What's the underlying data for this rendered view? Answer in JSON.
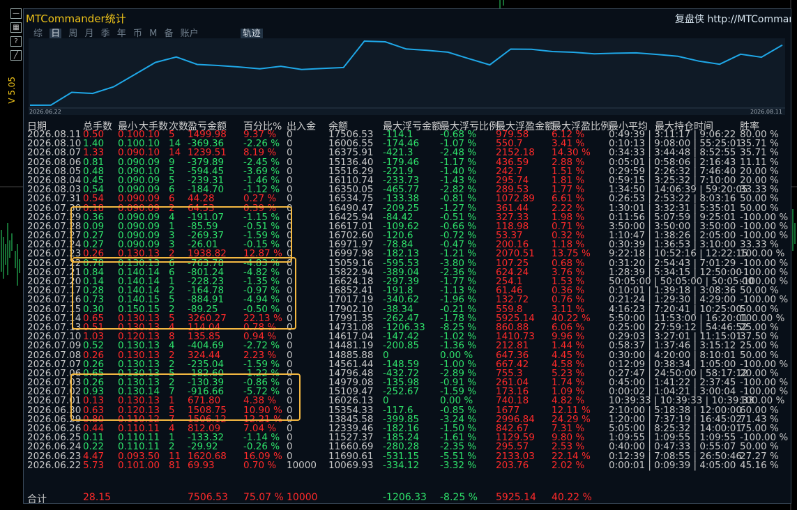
{
  "window": {
    "title": "MTCommander统计",
    "link": "复盘侠 http://MTCommander",
    "version": "V 5.05"
  },
  "tabs": [
    "综",
    "日",
    "周",
    "月",
    "季",
    "年",
    "币",
    "M",
    "备",
    "账户"
  ],
  "active_tab": "日",
  "track_button": "轨迹",
  "chart_data": {
    "type": "line",
    "title": "",
    "x_start_label": "2026.06.22",
    "x_end_label": "2026.08.11",
    "series": [
      {
        "values": [
          10069.93,
          10080,
          11660.69,
          11527.37,
          12339.46,
          13845.58,
          15354.33,
          16026.13,
          15109.47,
          14979.08,
          14796.48,
          14561.44,
          14885.88,
          14481.19,
          14617.04,
          14731.08,
          17991.35,
          17902.1,
          17017.19,
          16852.41,
          16624.18,
          15822.94,
          15059.16,
          16997.98,
          16971.97,
          16702.6,
          16617.01,
          16425.94,
          16490.47,
          16534.75,
          16350.05,
          16110.74,
          15516.29,
          15136.4,
          16375.91,
          16006.55,
          17506.53
        ]
      }
    ],
    "line_color": "#1fa8e8"
  },
  "columns": [
    "日期",
    "总手数",
    "最小",
    "大手数",
    "次数",
    "盈亏金额",
    "百分比%",
    "出入金",
    "余额",
    "最大浮亏金额",
    "最大浮亏比例",
    "最大浮盈金额",
    "最大浮盈比例",
    "最小平均",
    "最大持仓时间",
    "胜率"
  ],
  "rows": [
    {
      "date": "2026.08.11",
      "lots": "0.50",
      "mn": "0.10",
      "mx": "0.10",
      "cnt": "5",
      "pnl": "1499.98",
      "pct": "9.37 %",
      "io": "0",
      "bal": "17506.53",
      "fl": "-114.1",
      "flp": "-0.68 %",
      "fp": "979.58",
      "fpp": "6.12 %",
      "tm": "0:49:39 | 3:11:17 | 9:06:22",
      "win": "80.00 %",
      "s": 1
    },
    {
      "date": "2026.08.10",
      "lots": "1.40",
      "mn": "0.10",
      "mx": "0.10",
      "cnt": "14",
      "pnl": "-369.36",
      "pct": "-2.26 %",
      "io": "0",
      "bal": "16006.55",
      "fl": "-174.46",
      "flp": "-1.07 %",
      "fp": "550.7",
      "fpp": "3.41 %",
      "tm": "0:10:13 | 9:08:00 | 55:25:01",
      "win": "35.71 %",
      "s": -1
    },
    {
      "date": "2026.08.07",
      "lots": "1.33",
      "mn": "0.09",
      "mx": "0.10",
      "cnt": "14",
      "pnl": "1239.51",
      "pct": "8.19 %",
      "io": "0",
      "bal": "16375.91",
      "fl": "-421.3",
      "flp": "-2.48 %",
      "fp": "2152.18",
      "fpp": "14.30 %",
      "tm": "0:34:33 | 3:44:48 | 8:52:55",
      "win": "35.71 %",
      "s": 1
    },
    {
      "date": "2026.08.06",
      "lots": "0.81",
      "mn": "0.09",
      "mx": "0.09",
      "cnt": "9",
      "pnl": "-379.89",
      "pct": "-2.45 %",
      "io": "0",
      "bal": "15136.40",
      "fl": "-179.46",
      "flp": "-1.17 %",
      "fp": "436.59",
      "fpp": "2.88 %",
      "tm": "0:05:01 | 0:58:06 | 2:16:43",
      "win": "11.11 %",
      "s": -1
    },
    {
      "date": "2026.08.05",
      "lots": "0.48",
      "mn": "0.09",
      "mx": "0.10",
      "cnt": "5",
      "pnl": "-594.45",
      "pct": "-3.69 %",
      "io": "0",
      "bal": "15516.29",
      "fl": "-221.9",
      "flp": "-1.40 %",
      "fp": "242.7",
      "fpp": "1.51 %",
      "tm": "0:29:59 | 2:26:32 | 7:46:40",
      "win": "20.00 %",
      "s": -1
    },
    {
      "date": "2026.08.04",
      "lots": "0.45",
      "mn": "0.09",
      "mx": "0.09",
      "cnt": "5",
      "pnl": "-239.31",
      "pct": "-1.46 %",
      "io": "0",
      "bal": "16110.74",
      "fl": "-233.73",
      "flp": "-1.43 %",
      "fp": "295.74",
      "fpp": "1.81 %",
      "tm": "0:59:15 | 3:25:32 | 7:10:00",
      "win": "20.00 %",
      "s": -1
    },
    {
      "date": "2026.08.03",
      "lots": "0.54",
      "mn": "0.09",
      "mx": "0.09",
      "cnt": "6",
      "pnl": "-184.70",
      "pct": "-1.12 %",
      "io": "0",
      "bal": "16350.05",
      "fl": "-465.77",
      "flp": "-2.82 %",
      "fp": "289.53",
      "fpp": "1.77 %",
      "tm": "1:34:50 | 14:06:39 | 59:20:05",
      "win": "33.33 %",
      "s": -1
    },
    {
      "date": "2026.07.31",
      "lots": "0.54",
      "mn": "0.09",
      "mx": "0.09",
      "cnt": "6",
      "pnl": "44.28",
      "pct": "0.27 %",
      "io": "0",
      "bal": "16534.75",
      "fl": "-133.38",
      "flp": "-0.81 %",
      "fp": "1072.89",
      "fpp": "6.61 %",
      "tm": "0:26:53 | 2:53:22 | 8:03:16",
      "win": "50.00 %",
      "s": 1
    },
    {
      "date": "2026.07.30",
      "lots": "0.18",
      "mn": "0.09",
      "mx": "0.09",
      "cnt": "2",
      "pnl": "64.53",
      "pct": "0.39 %",
      "io": "0",
      "bal": "16490.47",
      "fl": "-209.25",
      "flp": "-1.27 %",
      "fp": "361.44",
      "fpp": "2.22 %",
      "tm": "1:30:01 | 3:32:31 | 5:35:01",
      "win": "50.00 %",
      "s": 1
    },
    {
      "date": "2026.07.29",
      "lots": "0.36",
      "mn": "0.09",
      "mx": "0.09",
      "cnt": "4",
      "pnl": "-191.07",
      "pct": "-1.15 %",
      "io": "0",
      "bal": "16425.94",
      "fl": "-84.42",
      "flp": "-0.51 %",
      "fp": "327.33",
      "fpp": "1.98 %",
      "tm": "0:11:56 | 5:07:59 | 9:25:01",
      "win": "-100.00 %",
      "s": -1
    },
    {
      "date": "2026.07.28",
      "lots": "0.09",
      "mn": "0.09",
      "mx": "0.09",
      "cnt": "1",
      "pnl": "-85.59",
      "pct": "-0.51 %",
      "io": "0",
      "bal": "16617.01",
      "fl": "-109.62",
      "flp": "-0.66 %",
      "fp": "118.98",
      "fpp": "0.71 %",
      "tm": "3:50:00 | 3:50:00 | 3:50:00",
      "win": "-100.00 %",
      "s": -1
    },
    {
      "date": "2026.07.27",
      "lots": "0.27",
      "mn": "0.09",
      "mx": "0.09",
      "cnt": "3",
      "pnl": "-269.37",
      "pct": "-1.59 %",
      "io": "0",
      "bal": "16702.60",
      "fl": "-120.6",
      "flp": "-0.72 %",
      "fp": "53.37",
      "fpp": "0.32 %",
      "tm": "1:10:47 | 1:38:26 | 2:05:00",
      "win": "-100.00 %",
      "s": -1
    },
    {
      "date": "2026.07.24",
      "lots": "0.27",
      "mn": "0.09",
      "mx": "0.09",
      "cnt": "3",
      "pnl": "-26.01",
      "pct": "-0.15 %",
      "io": "0",
      "bal": "16971.97",
      "fl": "-78.84",
      "flp": "-0.47 %",
      "fp": "200.16",
      "fpp": "1.18 %",
      "tm": "0:30:39 | 1:36:53 | 3:10:00",
      "win": "33.33 %",
      "s": -1
    },
    {
      "date": "2026.07.23",
      "lots": "0.26",
      "mn": "0.13",
      "mx": "0.13",
      "cnt": "2",
      "pnl": "1938.82",
      "pct": "12.87 %",
      "io": "0",
      "bal": "16997.98",
      "fl": "-182.13",
      "flp": "-1.21 %",
      "fp": "2070.51",
      "fpp": "13.75 %",
      "tm": "9:22:18 | 10:52:16 | 12:22:15",
      "win": "100.00 %",
      "s": 1
    },
    {
      "date": "2026.07.22",
      "lots": "0.78",
      "mn": "0.13",
      "mx": "0.13",
      "cnt": "6",
      "pnl": "-763.78",
      "pct": "-4.83 %",
      "io": "0",
      "bal": "15059.16",
      "fl": "-595.53",
      "flp": "-3.80 %",
      "fp": "107.25",
      "fpp": "0.68 %",
      "tm": "0:31:20 | 2:54:43 | 7:01:29",
      "win": "-100.00 %",
      "s": -1
    },
    {
      "date": "2026.07.21",
      "lots": "0.84",
      "mn": "0.14",
      "mx": "0.14",
      "cnt": "6",
      "pnl": "-801.24",
      "pct": "-4.82 %",
      "io": "0",
      "bal": "15822.94",
      "fl": "-389.04",
      "flp": "-2.36 %",
      "fp": "624.24",
      "fpp": "3.76 %",
      "tm": "1:28:39 | 5:34:15 | 12:50:00",
      "win": "-100.00 %",
      "s": -1
    },
    {
      "date": "2026.07.20",
      "lots": "0.14",
      "mn": "0.14",
      "mx": "0.14",
      "cnt": "1",
      "pnl": "-228.23",
      "pct": "-1.35 %",
      "io": "0",
      "bal": "16624.18",
      "fl": "-297.39",
      "flp": "-1.77 %",
      "fp": "254.1",
      "fpp": "1.53 %",
      "tm": "50:05:00 | 50:05:00 | 50:05:00",
      "win": "-100.00 %",
      "s": -1
    },
    {
      "date": "2026.07.17",
      "lots": "0.28",
      "mn": "0.14",
      "mx": "0.14",
      "cnt": "2",
      "pnl": "-164.78",
      "pct": "-0.97 %",
      "io": "0",
      "bal": "16852.41",
      "fl": "-191.8",
      "flp": "-1.13 %",
      "fp": "61.46",
      "fpp": "0.36 %",
      "tm": "0:10:01 | 1:39:18 | 3:08:36",
      "win": "50.00 %",
      "s": -1
    },
    {
      "date": "2026.07.16",
      "lots": "0.73",
      "mn": "0.14",
      "mx": "0.15",
      "cnt": "5",
      "pnl": "-884.91",
      "pct": "-4.94 %",
      "io": "0",
      "bal": "17017.19",
      "fl": "-340.62",
      "flp": "-1.96 %",
      "fp": "132.72",
      "fpp": "0.76 %",
      "tm": "0:21:24 | 1:29:30 | 4:29:00",
      "win": "-100.00 %",
      "s": -1
    },
    {
      "date": "2026.07.15",
      "lots": "0.30",
      "mn": "0.15",
      "mx": "0.15",
      "cnt": "2",
      "pnl": "-89.25",
      "pct": "-0.50 %",
      "io": "0",
      "bal": "17902.10",
      "fl": "-38.34",
      "flp": "-0.21 %",
      "fp": "559.8",
      "fpp": "3.11 %",
      "tm": "4:16:23 | 7:20:41 | 10:25:00",
      "win": "50.00 %",
      "s": -1
    },
    {
      "date": "2026.07.14",
      "lots": "0.65",
      "mn": "0.13",
      "mx": "0.13",
      "cnt": "5",
      "pnl": "3260.27",
      "pct": "22.13 %",
      "io": "0",
      "bal": "17991.35",
      "fl": "-262.47",
      "flp": "-1.78 %",
      "fp": "5925.14",
      "fpp": "40.22 %",
      "tm": "5:50:00 | 11:53:00 | 16:20:01",
      "win": "100.00 %",
      "s": 1
    },
    {
      "date": "2026.07.13",
      "lots": "0.51",
      "mn": "0.13",
      "mx": "0.13",
      "cnt": "4",
      "pnl": "114.04",
      "pct": "0.78 %",
      "io": "0",
      "bal": "14731.08",
      "fl": "-1206.33",
      "flp": "-8.25 %",
      "fp": "860.88",
      "fpp": "6.06 %",
      "tm": "0:25:00 | 27:59:12 | 54:46:52",
      "win": "25.00 %",
      "s": 1
    },
    {
      "date": "2026.07.10",
      "lots": "1.03",
      "mn": "0.12",
      "mx": "0.13",
      "cnt": "8",
      "pnl": "135.85",
      "pct": "0.94 %",
      "io": "0",
      "bal": "14617.04",
      "fl": "-147.42",
      "flp": "-1.02 %",
      "fp": "1410.73",
      "fpp": "9.96 %",
      "tm": "0:29:03 | 3:27:01 | 11:15:01",
      "win": "37.50 %",
      "s": 1
    },
    {
      "date": "2026.07.09",
      "lots": "0.52",
      "mn": "0.13",
      "mx": "0.13",
      "cnt": "4",
      "pnl": "-404.69",
      "pct": "-2.72 %",
      "io": "0",
      "bal": "14481.19",
      "fl": "-200.85",
      "flp": "-1.36 %",
      "fp": "212.81",
      "fpp": "1.44 %",
      "tm": "0:58:37 | 1:37:46 | 3:15:12",
      "win": "25.00 %",
      "s": -1
    },
    {
      "date": "2026.07.08",
      "lots": "0.26",
      "mn": "0.13",
      "mx": "0.13",
      "cnt": "2",
      "pnl": "324.44",
      "pct": "2.23 %",
      "io": "0",
      "bal": "14885.88",
      "fl": "0",
      "flp": "0.00 %",
      "fp": "647.36",
      "fpp": "4.45 %",
      "tm": "0:30:00 | 4:20:00 | 8:10:01",
      "win": "50.00 %",
      "s": 1
    },
    {
      "date": "2026.07.07",
      "lots": "0.26",
      "mn": "0.13",
      "mx": "0.13",
      "cnt": "2",
      "pnl": "-235.04",
      "pct": "-1.59 %",
      "io": "0",
      "bal": "14561.44",
      "fl": "-148.59",
      "flp": "-1.00 %",
      "fp": "667.42",
      "fpp": "4.58 %",
      "tm": "0:12:09 | 0:38:34 | 1:05:00",
      "win": "-100.00 %",
      "s": -1
    },
    {
      "date": "2026.07.06",
      "lots": "0.65",
      "mn": "0.13",
      "mx": "0.13",
      "cnt": "5",
      "pnl": "-182.60",
      "pct": "-1.22 %",
      "io": "0",
      "bal": "14796.48",
      "fl": "-432.72",
      "flp": "-2.89 %",
      "fp": "755.3",
      "fpp": "5.23 %",
      "tm": "0:27:47 | 24:50:00 | 58:17:12",
      "win": "20.00 %",
      "s": -1
    },
    {
      "date": "2026.07.03",
      "lots": "0.26",
      "mn": "0.13",
      "mx": "0.13",
      "cnt": "2",
      "pnl": "-130.39",
      "pct": "-0.86 %",
      "io": "0",
      "bal": "14979.08",
      "fl": "-135.98",
      "flp": "-0.91 %",
      "fp": "261.04",
      "fpp": "1.74 %",
      "tm": "0:45:00 | 1:41:22 | 2:37:45",
      "win": "-100.00 %",
      "s": -1
    },
    {
      "date": "2026.07.02",
      "lots": "0.93",
      "mn": "0.13",
      "mx": "0.14",
      "cnt": "7",
      "pnl": "-916.66",
      "pct": "-5.72 %",
      "io": "0",
      "bal": "15109.47",
      "fl": "-252.67",
      "flp": "-1.59 %",
      "fp": "173.16",
      "fpp": "1.09 %",
      "tm": "0:00:02 | 1:04:21 | 3:00:04",
      "win": "-100.00 %",
      "s": -1
    },
    {
      "date": "2026.07.01",
      "lots": "0.13",
      "mn": "0.13",
      "mx": "0.13",
      "cnt": "1",
      "pnl": "671.80",
      "pct": "4.38 %",
      "io": "0",
      "bal": "16026.13",
      "fl": "0",
      "flp": "0.00 %",
      "fp": "740.18",
      "fpp": "4.82 %",
      "tm": "10:39:33 | 10:39:33 | 10:39:33",
      "win": "100.00 %",
      "s": 1
    },
    {
      "date": "2026.06.30",
      "lots": "0.63",
      "mn": "0.12",
      "mx": "0.13",
      "cnt": "5",
      "pnl": "1508.75",
      "pct": "10.90 %",
      "io": "0",
      "bal": "15354.33",
      "fl": "-117.6",
      "flp": "-0.85 %",
      "fp": "1677",
      "fpp": "12.11 %",
      "tm": "2:10:00 | 5:18:38 | 12:00:00",
      "win": "60.00 %",
      "s": 1
    },
    {
      "date": "2026.06.29",
      "lots": "0.80",
      "mn": "0.11",
      "mx": "0.12",
      "cnt": "7",
      "pnl": "1506.12",
      "pct": "12.21 %",
      "io": "0",
      "bal": "13845.58",
      "fl": "-399.85",
      "flp": "-3.24 %",
      "fp": "2996.84",
      "fpp": "24.29 %",
      "tm": "1:20:00 | 7:37:19 | 16:45:02",
      "win": "71.43 %",
      "s": 1
    },
    {
      "date": "2026.06.26",
      "lots": "0.44",
      "mn": "0.11",
      "mx": "0.11",
      "cnt": "4",
      "pnl": "812.09",
      "pct": "7.04 %",
      "io": "0",
      "bal": "12339.46",
      "fl": "-182.16",
      "flp": "-1.50 %",
      "fp": "842.67",
      "fpp": "7.31 %",
      "tm": "5:05:00 | 8:25:32 | 14:00:01",
      "win": "75.00 %",
      "s": 1
    },
    {
      "date": "2026.06.25",
      "lots": "0.11",
      "mn": "0.11",
      "mx": "0.11",
      "cnt": "1",
      "pnl": "-133.32",
      "pct": "-1.14 %",
      "io": "0",
      "bal": "11527.37",
      "fl": "-185.24",
      "flp": "-1.61 %",
      "fp": "1129.59",
      "fpp": "9.80 %",
      "tm": "1:09:55 | 1:09:55 | 1:09:55",
      "win": "-100.00 %",
      "s": -1
    },
    {
      "date": "2026.06.24",
      "lots": "0.22",
      "mn": "0.11",
      "mx": "0.11",
      "cnt": "2",
      "pnl": "-29.92",
      "pct": "-0.26 %",
      "io": "0",
      "bal": "11660.69",
      "fl": "-280.28",
      "flp": "-2.35 %",
      "fp": "295.57",
      "fpp": "2.53 %",
      "tm": "0:40:00 | 0:47:33 | 0:55:07",
      "win": "50.00 %",
      "s": -1
    },
    {
      "date": "2026.06.23",
      "lots": "4.47",
      "mn": "0.09",
      "mx": "3.50",
      "cnt": "11",
      "pnl": "1620.68",
      "pct": "16.09 %",
      "io": "0",
      "bal": "11690.61",
      "fl": "-531.15",
      "flp": "-5.51 %",
      "fp": "2133.03",
      "fpp": "22.14 %",
      "tm": "0:12:39 | 7:08:55 | 26:50:46",
      "win": "27.27 %",
      "s": 1
    },
    {
      "date": "2026.06.22",
      "lots": "5.73",
      "mn": "0.10",
      "mx": "1.00",
      "cnt": "81",
      "pnl": "69.93",
      "pct": "0.70 %",
      "io": "10000",
      "bal": "10069.93",
      "fl": "-334.12",
      "flp": "-3.32 %",
      "fp": "203.76",
      "fpp": "2.02 %",
      "tm": "0:00:01 | 0:09:39 | 4:05:00",
      "win": "45.16 %",
      "s": 1
    }
  ],
  "totals": {
    "label": "合计",
    "lots": "28.15",
    "pnl": "7506.53",
    "pct": "75.07 %",
    "io": "10000",
    "fl": "-1206.33",
    "flp": "-8.25 %",
    "fp": "5925.14",
    "fpp": "40.22 %"
  },
  "colors": {
    "accent": "#f0c419",
    "profit": "#ff2a2a",
    "loss": "#2ee06a",
    "highlight": "#f5b942"
  }
}
